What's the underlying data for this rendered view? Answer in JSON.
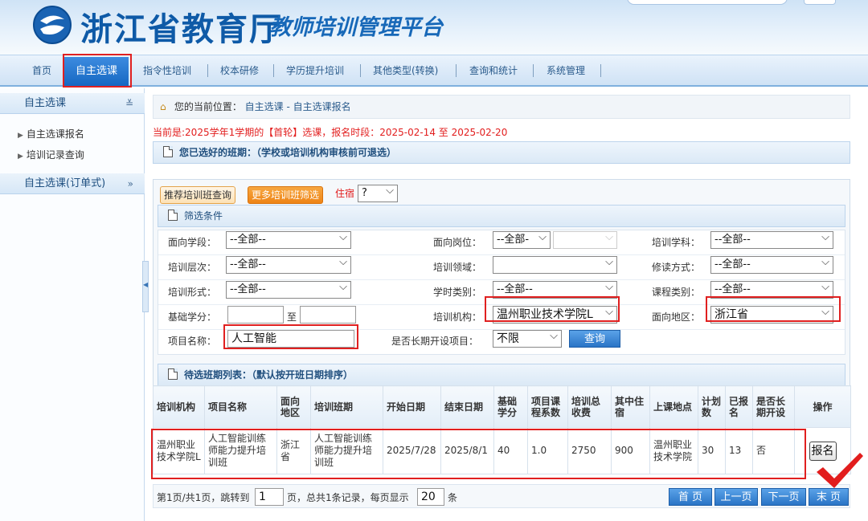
{
  "header": {
    "org_title": "浙江省教育厅",
    "platform_title": "教师培训管理平台"
  },
  "nav": {
    "items": [
      "首页",
      "自主选课",
      "指令性培训",
      "校本研修",
      "学历提升培训",
      "其他类型(转换)",
      "查询和统计",
      "系统管理"
    ]
  },
  "sidebar": {
    "section1": "自主选课",
    "items": [
      "自主选课报名",
      "培训记录查询"
    ],
    "section2": "自主选课(订单式)"
  },
  "breadcrumb": {
    "prefix": "您的当前位置：",
    "level1": "自主选课 -",
    "level2": "自主选课报名"
  },
  "notice": "当前是:2025学年1学期的【首轮】选课，报名时段：2025-02-14 至 2025-02-20",
  "selected_section": "您已选好的班期：（学校或培训机构审核前可退选）",
  "filter": {
    "tab_recommend": "推荐培训班查询",
    "tab_more": "更多培训班筛选",
    "stay_label": "住宿",
    "stay_value": "?",
    "section_title": "筛选条件",
    "labels": {
      "stage": "面向学段：",
      "post": "面向岗位：",
      "subject": "培训学科：",
      "level": "培训层次：",
      "field": "培训领域：",
      "study_mode": "修读方式：",
      "form": "培训形式：",
      "hour_type": "学时类别：",
      "course_type": "课程类别：",
      "credits": "基础学分：",
      "to": "至",
      "institution": "培训机构：",
      "region": "面向地区：",
      "project_name": "项目名称：",
      "long_term": "是否长期开设项目："
    },
    "values": {
      "stage": "--全部--",
      "post": "--全部-",
      "subject": "--全部--",
      "level": "--全部--",
      "field": "",
      "study_mode": "--全部--",
      "form": "--全部--",
      "hour_type": "--全部--",
      "course_type": "--全部--",
      "credits_from": "",
      "credits_to": "",
      "institution": "温州职业技术学院L",
      "region": "浙江省",
      "project_name": "人工智能",
      "long_term": "不限"
    },
    "query_button": "查询"
  },
  "results": {
    "section_title": "待选班期列表：（默认按开班日期排序）",
    "columns": [
      "培训机构",
      "项目名称",
      "面向地区",
      "培训班期",
      "开始日期",
      "结束日期",
      "基础学分",
      "项目课程系数",
      "培训总收费",
      "其中住宿",
      "上课地点",
      "计划数",
      "已报名",
      "是否长期开设",
      "操作"
    ],
    "rows": [
      {
        "institution": "温州职业技术学院L",
        "project": "人工智能训练师能力提升培训班",
        "region": "浙江省",
        "session": "人工智能训练师能力提升培训班",
        "start": "2025/7/28",
        "end": "2025/8/1",
        "credits": "40",
        "coef": "1.0",
        "fee": "2750",
        "lodging": "900",
        "location": "温州职业技术学院",
        "plan": "30",
        "enrolled": "13",
        "long_term": "否",
        "action": "报名"
      }
    ]
  },
  "pager": {
    "prefix": "第1页/共1页，跳转到",
    "page_value": "1",
    "middle": "页，总共1条记录，每页显示",
    "per_page_value": "20",
    "suffix": "条",
    "first": "首 页",
    "prev": "上一页",
    "next": "下一页",
    "last": "末 页"
  },
  "colors": {
    "brand_blue": "#0e5aa7",
    "highlight_red": "#e02020",
    "accent_orange": "#ee8416"
  }
}
